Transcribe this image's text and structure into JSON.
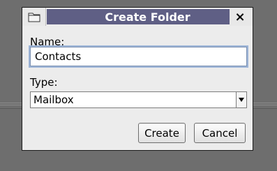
{
  "dialog": {
    "title": "Create Folder",
    "close_label": "×",
    "name_label": "Name:",
    "name_value": "Contacts",
    "type_label": "Type:",
    "type_selected": "Mailbox",
    "create_label": "Create",
    "cancel_label": "Cancel"
  },
  "icons": {
    "title_icon": "folder-icon",
    "close_icon": "close-icon",
    "select_arrow": "chevron-down-icon"
  },
  "colors": {
    "title_bar": "#5f5f85",
    "dialog_bg": "#ececec",
    "backdrop": "#6e6e6e",
    "input_focus": "#9fb6d8"
  }
}
